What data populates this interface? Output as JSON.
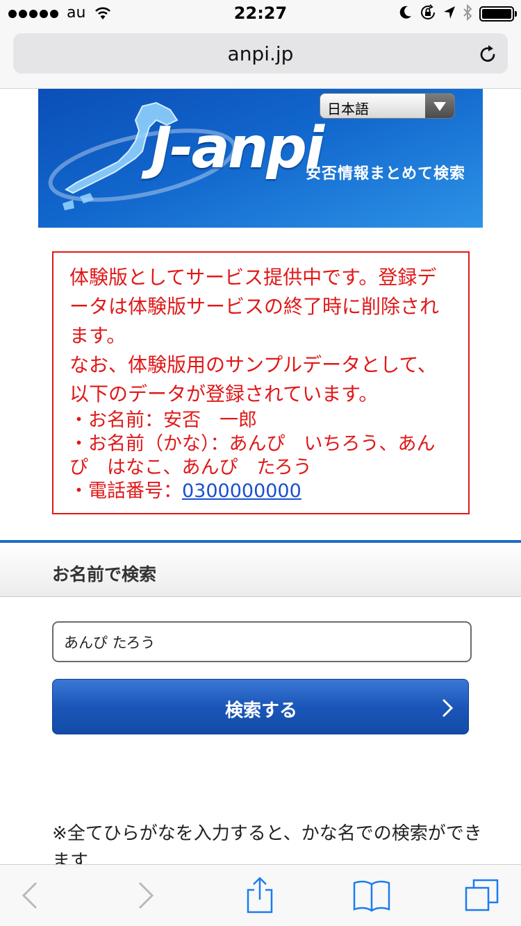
{
  "status_bar": {
    "carrier": "au",
    "time": "22:27",
    "battery_level": 1.0
  },
  "browser": {
    "url": "anpi.jp"
  },
  "banner": {
    "language_selected": "日本語",
    "logo_text": "J-anpi",
    "tagline": "安否情報まとめて検索"
  },
  "notice": {
    "paragraph1": "体験版としてサービス提供中です。登録データは体験版サービスの終了時に削除されます。",
    "paragraph2": "なお、体験版用のサンプルデータとして、以下のデータが登録されています。",
    "item_name": "・お名前：安否　一郎",
    "item_kana": "・お名前（かな）：あんぴ　いちろう、あんぴ　はなこ、あんぴ　たろう",
    "item_phone_label": "・電話番号：",
    "item_phone_value": "0300000000"
  },
  "search": {
    "section_title": "お名前で検索",
    "input_value": "あんぴ たろう",
    "button_label": "検索する",
    "note": "※全てひらがなを入力すると、かな名での検索ができます"
  },
  "icons": {
    "signal": "signal-dots-icon",
    "wifi": "wifi-icon",
    "moon": "moon-icon",
    "lock": "rotation-lock-icon",
    "location": "location-arrow-icon",
    "bluetooth": "bluetooth-icon",
    "reload": "reload-icon",
    "back": "back-chevron-icon",
    "forward": "forward-chevron-icon",
    "share": "share-icon",
    "bookmarks": "bookmarks-icon",
    "tabs": "tabs-icon"
  },
  "colors": {
    "notice_red": "#e01818",
    "link_blue": "#1a4fcf",
    "button_blue": "#1b56b8",
    "section_rule": "#1c6cc4",
    "ios_tint": "#1a7cf0"
  }
}
